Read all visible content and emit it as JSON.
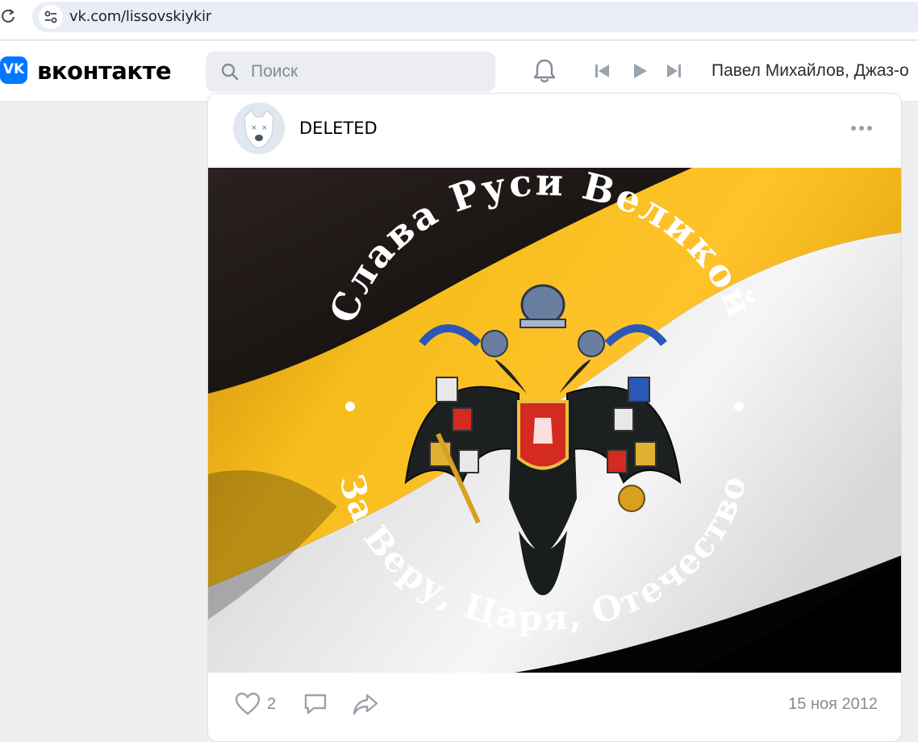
{
  "browser": {
    "url": "vk.com/lissovskiykir"
  },
  "header": {
    "brand": "вконтакте",
    "logo_letters": "VK",
    "search_placeholder": "Поиск",
    "now_playing": "Павел Михайлов, Джаз-о"
  },
  "post": {
    "author": "DELETED",
    "image_texts": {
      "top_arc": "Слава Руси Великой",
      "bottom_arc": "За Веру, Царя, Отечество"
    },
    "likes": "2",
    "date": "15 ноя 2012"
  },
  "colors": {
    "vk_blue": "#0077ff",
    "flag_black": "#141010",
    "flag_gold": "#f2b418",
    "flag_white": "#f0f0f0"
  }
}
